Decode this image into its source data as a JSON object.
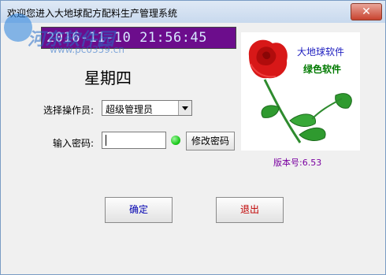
{
  "window": {
    "title": "欢迎您进入大地球配方配料生产管理系统",
    "close_label": "✕"
  },
  "datetime": "2016-11-10 21:56:45",
  "weekday": "星期四",
  "operator": {
    "label": "选择操作员:",
    "selected": "超级管理员"
  },
  "password": {
    "label": "输入密码:",
    "value": ""
  },
  "buttons": {
    "change_password": "修改密码",
    "ok": "确定",
    "exit": "退出"
  },
  "brand": {
    "line1": "大地球软件",
    "line2": "绿色软件"
  },
  "version": "版本号:6.53",
  "watermark": {
    "text": "河东软件园",
    "url": "www.pc0359.cn"
  },
  "colors": {
    "datetime_bg": "#6c0d8c",
    "status_green": "#1fcc1f",
    "ok_text": "#0000b0",
    "exit_text": "#c00000",
    "version_text": "#7a00a0"
  }
}
